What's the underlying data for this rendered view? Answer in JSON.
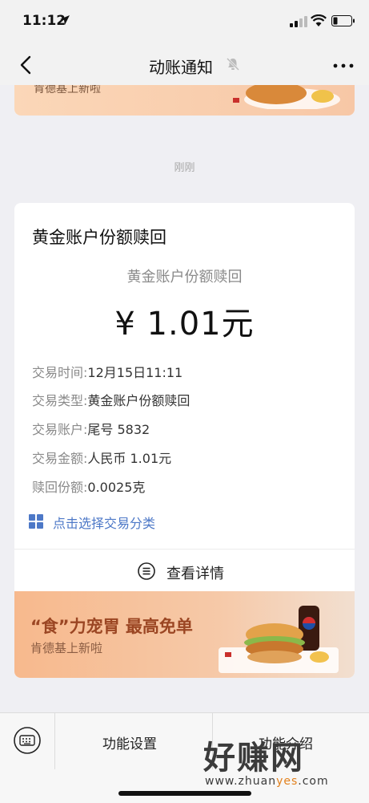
{
  "status_bar": {
    "time": "11:12"
  },
  "nav": {
    "title": "动账通知"
  },
  "top_banner": {
    "subtitle": "肯德基上新啦"
  },
  "message": {
    "timestamp": "刚刚",
    "title": "黄金账户份额赎回",
    "amount_label": "黄金账户份额赎回",
    "amount": "¥ 1.01元",
    "rows": [
      {
        "key": "交易时间:",
        "value": "12月15日11:11"
      },
      {
        "key": "交易类型:",
        "value": "黄金账户份额赎回"
      },
      {
        "key": "交易账户:",
        "value": "尾号 5832"
      },
      {
        "key": "交易金额:",
        "value": "人民币 1.01元"
      },
      {
        "key": "赎回份额:",
        "value": "0.0025克"
      }
    ],
    "classify_label": "点击选择交易分类",
    "detail_label": "查看详情"
  },
  "ad_banner": {
    "title": "“食”力宠胃  最高免单",
    "subtitle": "肯德基上新啦"
  },
  "bottom_menu": {
    "item1": "功能设置",
    "item2": "功能介绍"
  },
  "watermark": {
    "big": "好赚网",
    "small_prefix": "www.zhuan",
    "small_accent": "yes",
    "small_suffix": ".com"
  }
}
